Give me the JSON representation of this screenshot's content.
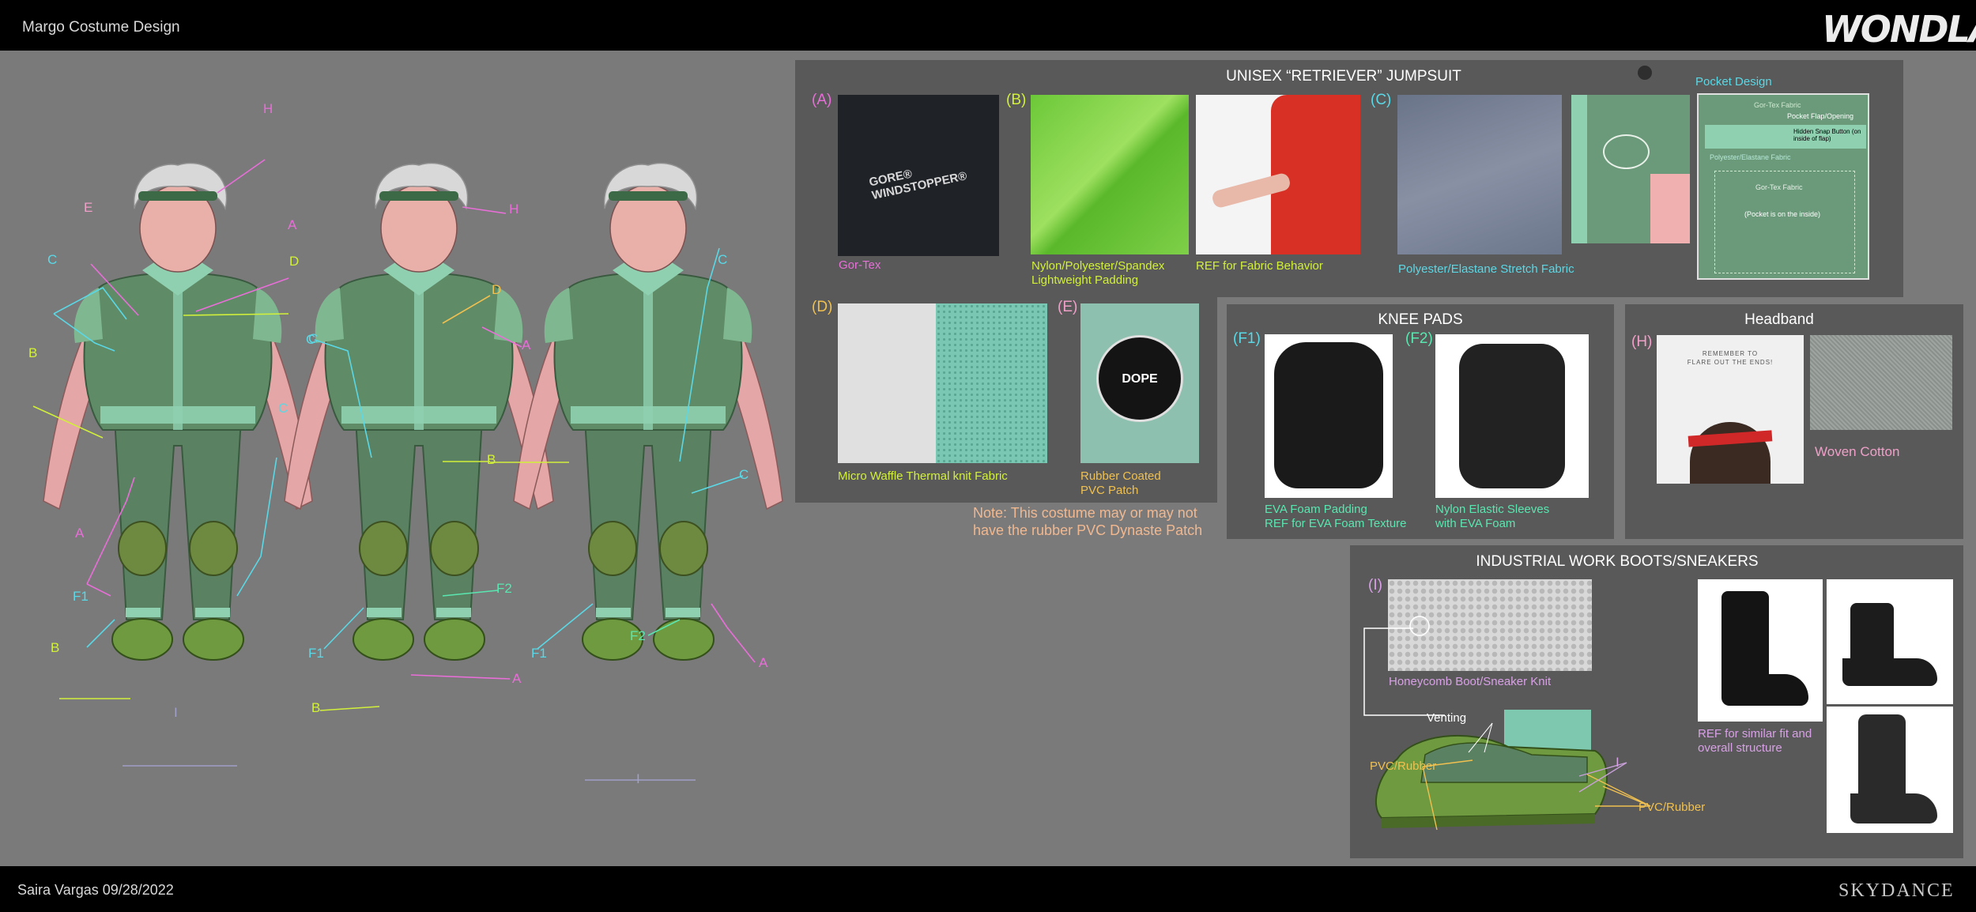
{
  "header": {
    "title": "Margo Costume Design",
    "logo": "WONDLA"
  },
  "footer": {
    "credit": "Saira Vargas 09/28/2022",
    "studio": "SKYDANCE"
  },
  "figure_labels": {
    "front": [
      "H",
      "E",
      "A",
      "C",
      "D",
      "B",
      "C",
      "C",
      "A",
      "F1",
      "B",
      "I"
    ],
    "side": [
      "H",
      "D",
      "C",
      "A",
      "B",
      "F2",
      "F1",
      "B",
      "A"
    ],
    "back": [
      "C",
      "B",
      "C",
      "F1",
      "F2",
      "A",
      "I"
    ]
  },
  "jumpsuit": {
    "title": "UNISEX “RETRIEVER” JUMPSUIT",
    "a_tag": "(A)",
    "a_label": "Gor-Tex",
    "a_print": "GORE® WINDSTOPPER®",
    "b_tag": "(B)",
    "b_label": "Nylon/Polyester/Spandex\nLightweight Padding",
    "b2_label": "REF for Fabric Behavior",
    "c_tag": "(C)",
    "c_label": "Polyester/Elastane Stretch Fabric",
    "pocket_title": "Pocket Design",
    "pocket_notes": [
      "Gor-Tex Fabric",
      "Pocket Flap/Opening",
      "Hidden Snap Button (on inside of flap)",
      "Polyester/Elastane Fabric",
      "Gor-Tex Fabric",
      "(Pocket is on the inside)"
    ],
    "d_tag": "(D)",
    "d_label": "Micro Waffle Thermal knit Fabric",
    "e_tag": "(E)",
    "e_label": "Rubber Coated\nPVC Patch",
    "e_patch": "DOPE"
  },
  "note": "Note: This costume may or may not\nhave the rubber PVC Dynaste Patch",
  "knee": {
    "title": "KNEE PADS",
    "f1_tag": "(F1)",
    "f1_label": "EVA Foam Padding\nREF for EVA Foam Texture",
    "f2_tag": "(F2)",
    "f2_label": "Nylon Elastic Sleeves\nwith EVA Foam"
  },
  "headband": {
    "title": "Headband",
    "h_tag": "(H)",
    "ref_text": "REMEMBER TO\nFLARE OUT THE ENDS!",
    "label": "Woven Cotton"
  },
  "boots": {
    "title": "INDUSTRIAL WORK BOOTS/SNEAKERS",
    "i_tag": "(I)",
    "i_label": "Honeycomb Boot/Sneaker Knit",
    "venting": "Venting",
    "pvc_left": "PVC/Rubber",
    "pvc_right": "PVC/Rubber",
    "i_mark": "I",
    "ref_label": "REF for similar fit and\noverall structure"
  },
  "colors": {
    "panel": "#595959",
    "bg": "#7a7a7a",
    "suit": "#5f8b67",
    "trim": "#8fd0b0",
    "skin": "#e8a8a8"
  }
}
